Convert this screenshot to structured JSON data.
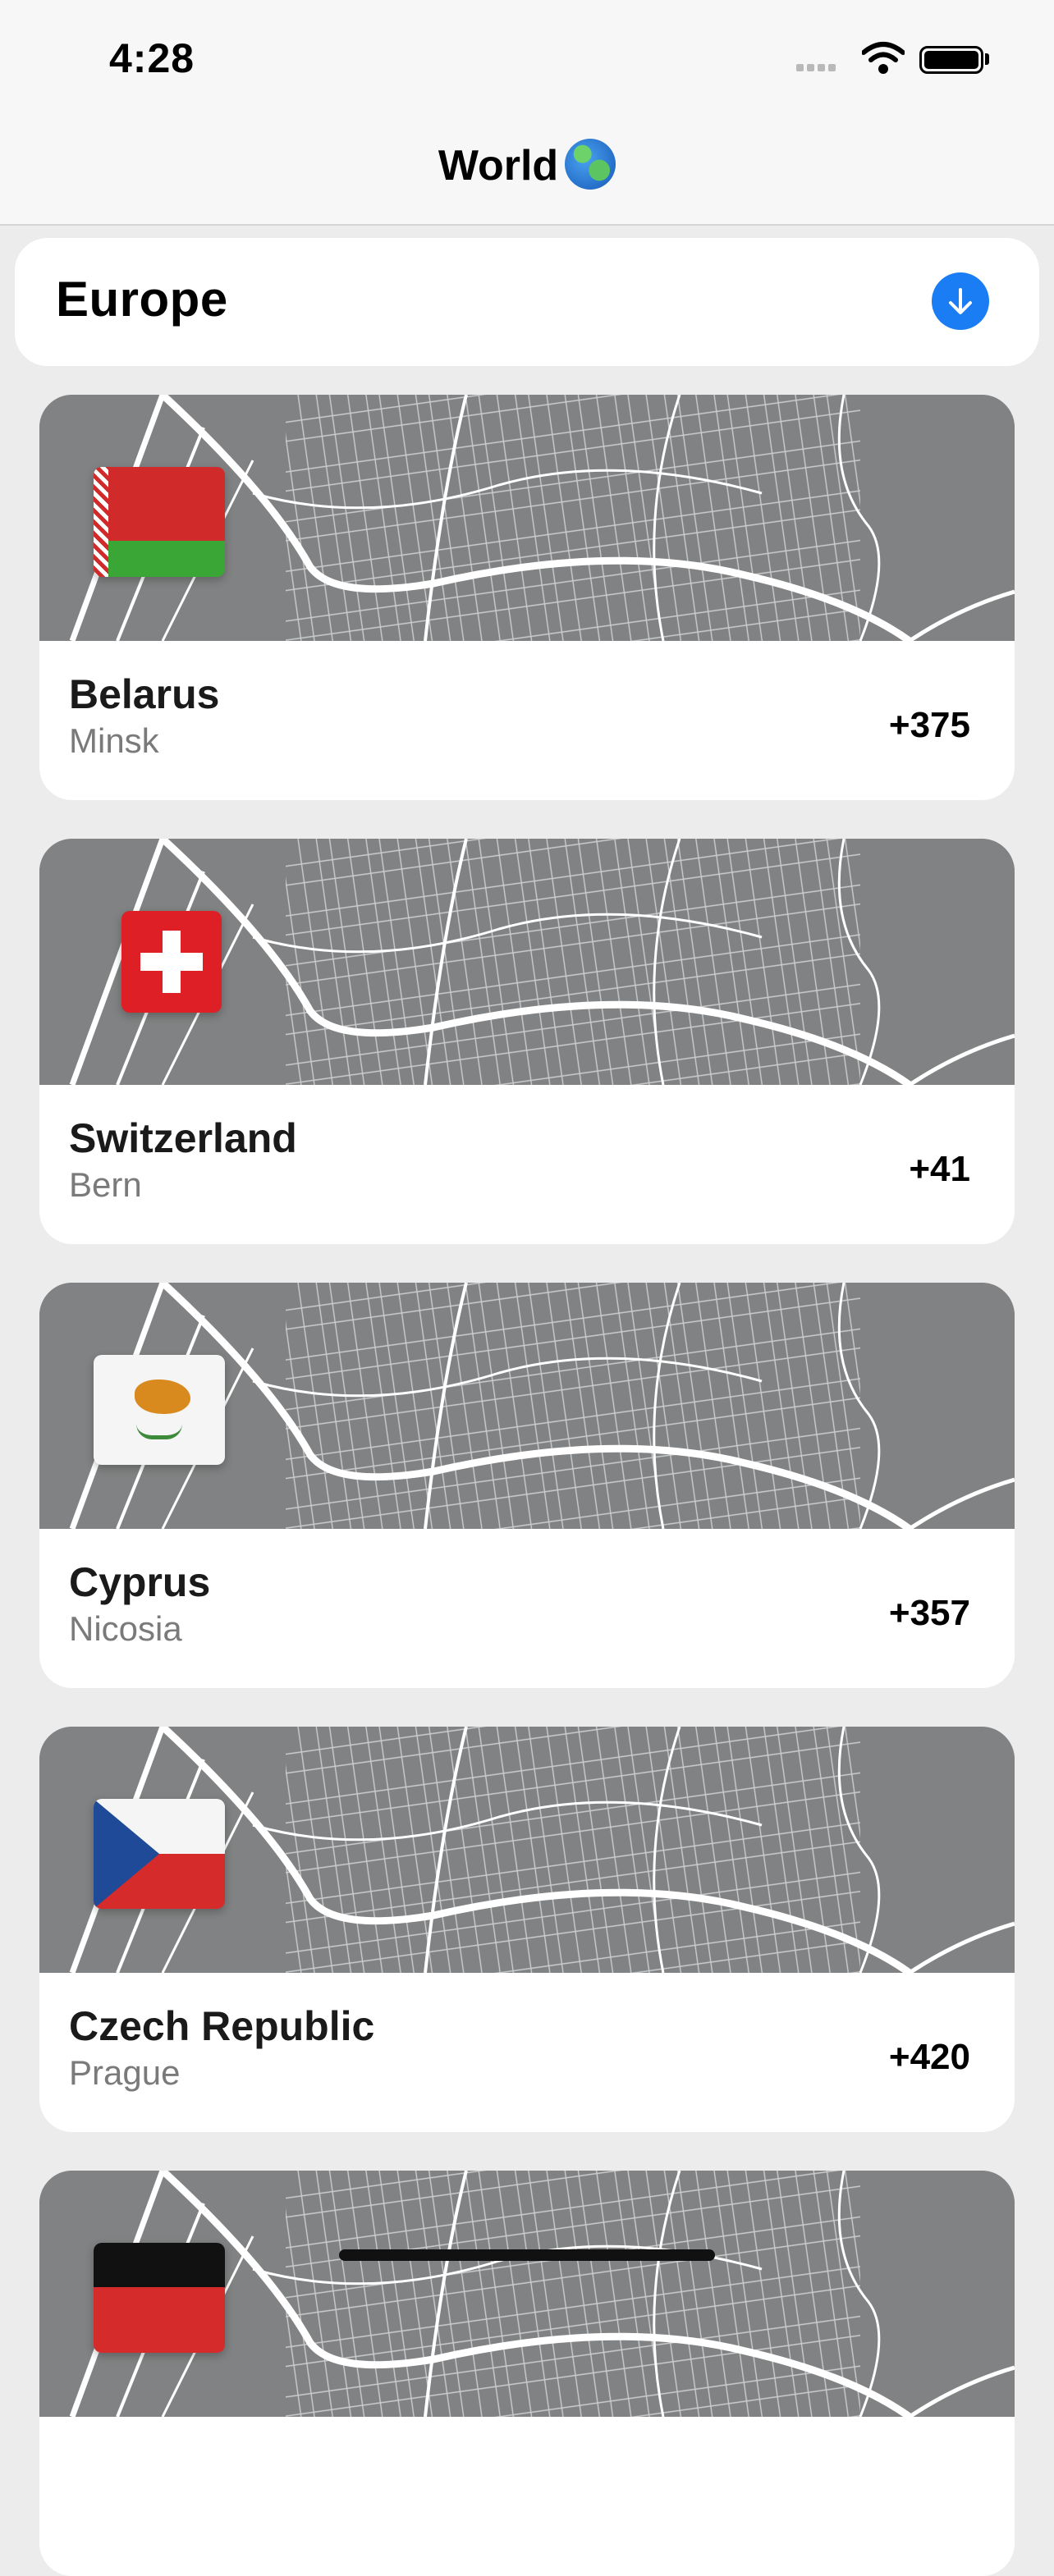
{
  "status_bar": {
    "time": "4:28"
  },
  "nav": {
    "title": "World",
    "title_icon": "globe-emoji-icon"
  },
  "section": {
    "title": "Europe",
    "action_icon": "arrow-down-circle-icon",
    "accent": "#1a7df3"
  },
  "countries": [
    {
      "name": "Belarus",
      "capital": "Minsk",
      "code": "+375",
      "flag": "belarus-flag-icon"
    },
    {
      "name": "Switzerland",
      "capital": "Bern",
      "code": "+41",
      "flag": "switzerland-flag-icon"
    },
    {
      "name": "Cyprus",
      "capital": "Nicosia",
      "code": "+357",
      "flag": "cyprus-flag-icon"
    },
    {
      "name": "Czech Republic",
      "capital": "Prague",
      "code": "+420",
      "flag": "czech-flag-icon"
    }
  ]
}
